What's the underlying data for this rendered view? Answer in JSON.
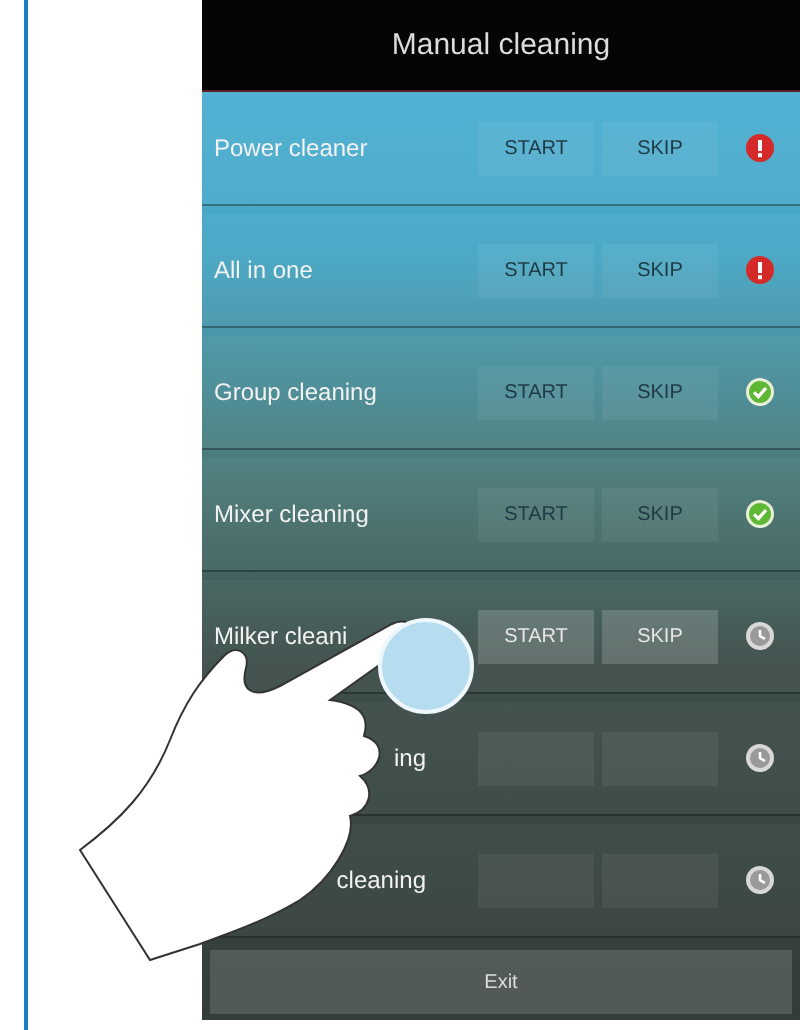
{
  "title": "Manual cleaning",
  "rows": [
    {
      "name": "Power cleaner",
      "start": "START",
      "skip": "SKIP",
      "disabled": true,
      "cut": false,
      "kind": "error"
    },
    {
      "name": "All in one",
      "start": "START",
      "skip": "SKIP",
      "disabled": true,
      "cut": false,
      "kind": "error"
    },
    {
      "name": "Group cleaning",
      "start": "START",
      "skip": "SKIP",
      "disabled": true,
      "cut": false,
      "kind": "done"
    },
    {
      "name": "Mixer cleaning",
      "start": "START",
      "skip": "SKIP",
      "disabled": true,
      "cut": false,
      "kind": "done"
    },
    {
      "name": "Milker cleani",
      "start": "START",
      "skip": "SKIP",
      "disabled": false,
      "cut": false,
      "kind": "pending"
    },
    {
      "name": "ing",
      "disabled": true,
      "cut": true,
      "kind": "pending"
    },
    {
      "name": "cleaning",
      "disabled": true,
      "cut": true,
      "kind": "pending"
    }
  ],
  "exit": "Exit"
}
